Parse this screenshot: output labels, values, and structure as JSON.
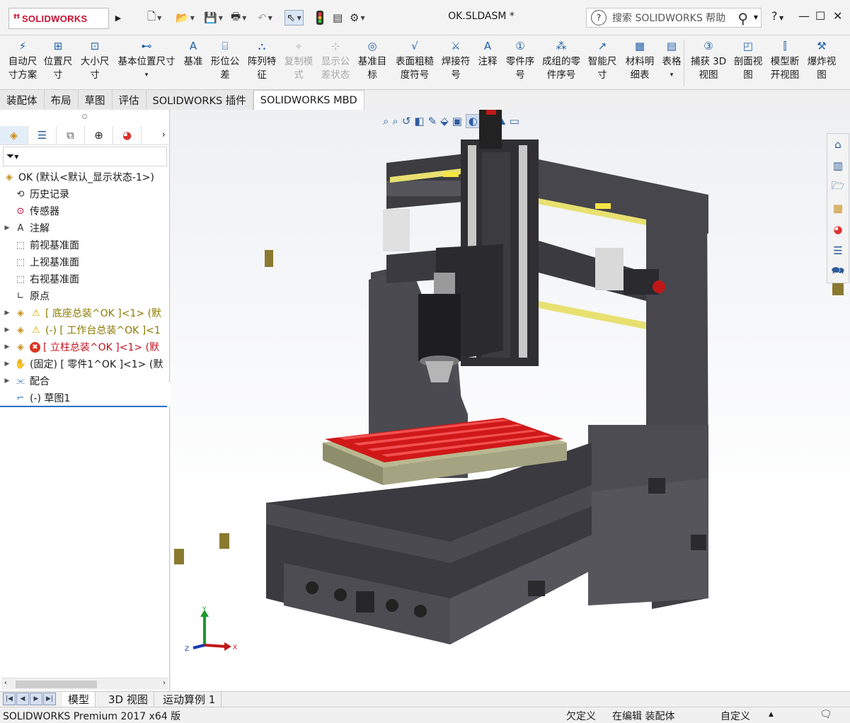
{
  "app": {
    "logo_text": "SOLIDWORKS",
    "document_title": "OK.SLDASM *",
    "search_placeholder": "搜索 SOLIDWORKS 帮助",
    "help_label": "?"
  },
  "ribbon": {
    "buttons": [
      {
        "label1": "自动尺",
        "label2": "寸方案",
        "icon": "auto-dimension-icon",
        "enabled": true
      },
      {
        "label1": "位置尺",
        "label2": "寸",
        "icon": "location-dimension-icon",
        "enabled": true
      },
      {
        "label1": "大小尺",
        "label2": "寸",
        "icon": "size-dimension-icon",
        "enabled": true
      },
      {
        "label1": "基本位置尺寸",
        "label2": "",
        "icon": "basic-location-dimension-icon",
        "enabled": true
      },
      {
        "label1": "基准",
        "label2": "",
        "icon": "datum-icon",
        "enabled": true
      },
      {
        "label1": "形位公",
        "label2": "差",
        "icon": "geometric-tolerance-icon",
        "enabled": true
      },
      {
        "label1": "阵列特",
        "label2": "征",
        "icon": "pattern-feature-icon",
        "enabled": true
      },
      {
        "label1": "复制模",
        "label2": "式",
        "icon": "copy-scheme-icon",
        "enabled": false
      },
      {
        "label1": "显示公",
        "label2": "差状态",
        "icon": "show-tolerance-status-icon",
        "enabled": false
      },
      {
        "label1": "基准目",
        "label2": "标",
        "icon": "datum-target-icon",
        "enabled": true
      },
      {
        "label1": "表面粗糙",
        "label2": "度符号",
        "icon": "surface-finish-icon",
        "enabled": true
      },
      {
        "label1": "焊接符",
        "label2": "号",
        "icon": "weld-symbol-icon",
        "enabled": true
      },
      {
        "label1": "注释",
        "label2": "",
        "icon": "note-icon",
        "enabled": true
      },
      {
        "label1": "零件序",
        "label2": "号",
        "icon": "balloon-icon",
        "enabled": true
      },
      {
        "label1": "成组的零",
        "label2": "件序号",
        "icon": "stacked-balloon-icon",
        "enabled": true
      },
      {
        "label1": "智能尺",
        "label2": "寸",
        "icon": "smart-dimension-icon",
        "enabled": true
      },
      {
        "label1": "材料明",
        "label2": "细表",
        "icon": "bom-icon",
        "enabled": true
      },
      {
        "label1": "表格",
        "label2": "",
        "icon": "table-icon",
        "enabled": true
      },
      {
        "label1": "捕获 3D",
        "label2": "视图",
        "icon": "capture-3d-view-icon",
        "enabled": true
      },
      {
        "label1": "剖面视",
        "label2": "图",
        "icon": "section-view-icon",
        "enabled": true
      },
      {
        "label1": "模型断",
        "label2": "开视图",
        "icon": "model-break-view-icon",
        "enabled": true
      },
      {
        "label1": "爆炸视",
        "label2": "图",
        "icon": "exploded-view-icon",
        "enabled": true
      }
    ]
  },
  "command_tabs": [
    {
      "label": "装配体",
      "active": false
    },
    {
      "label": "布局",
      "active": false
    },
    {
      "label": "草图",
      "active": false
    },
    {
      "label": "评估",
      "active": false
    },
    {
      "label": "SOLIDWORKS 插件",
      "active": false
    },
    {
      "label": "SOLIDWORKS MBD",
      "active": true
    }
  ],
  "feature_tree": {
    "root": "OK  (默认<默认_显示状态-1>)",
    "items": [
      {
        "label": "历史记录",
        "icon": "history-icon",
        "expandable": false,
        "status": "normal"
      },
      {
        "label": "传感器",
        "icon": "sensor-icon",
        "expandable": false,
        "status": "normal"
      },
      {
        "label": "注解",
        "icon": "annotations-icon",
        "expandable": true,
        "status": "normal"
      },
      {
        "label": "前视基准面",
        "icon": "plane-icon",
        "expandable": false,
        "status": "normal"
      },
      {
        "label": "上视基准面",
        "icon": "plane-icon",
        "expandable": false,
        "status": "normal"
      },
      {
        "label": "右视基准面",
        "icon": "plane-icon",
        "expandable": false,
        "status": "normal"
      },
      {
        "label": "原点",
        "icon": "origin-icon",
        "expandable": false,
        "status": "normal"
      },
      {
        "label": "[ 底座总装^OK ]<1> (默",
        "icon": "subassembly-icon",
        "expandable": true,
        "status": "warning"
      },
      {
        "label": "(-) [ 工作台总装^OK ]<1",
        "icon": "subassembly-icon",
        "expandable": true,
        "status": "warning"
      },
      {
        "label": "[ 立柱总装^OK ]<1> (默",
        "icon": "subassembly-icon",
        "expandable": true,
        "status": "error"
      },
      {
        "label": "(固定) [ 零件1^OK ]<1> (默",
        "icon": "part-icon",
        "expandable": true,
        "status": "normal"
      },
      {
        "label": "配合",
        "icon": "mates-icon",
        "expandable": true,
        "status": "normal"
      },
      {
        "label": "(-) 草图1",
        "icon": "sketch-icon",
        "expandable": false,
        "status": "normal"
      }
    ]
  },
  "bottom_tabs": [
    {
      "label": "模型",
      "active": true
    },
    {
      "label": "3D 视图",
      "active": false
    },
    {
      "label": "运动算例 1",
      "active": false
    }
  ],
  "status_bar": {
    "product": "SOLIDWORKS Premium 2017 x64 版",
    "definition": "欠定义",
    "mode": "在编辑 装配体",
    "units": "自定义"
  },
  "colors": {
    "brand_red": "#c8102e",
    "machine_body": "#4a4a4f",
    "table_top": "#d01818",
    "rail_yellow": "#e8e070",
    "warning": "#8a7a00",
    "error": "#c0141e"
  }
}
